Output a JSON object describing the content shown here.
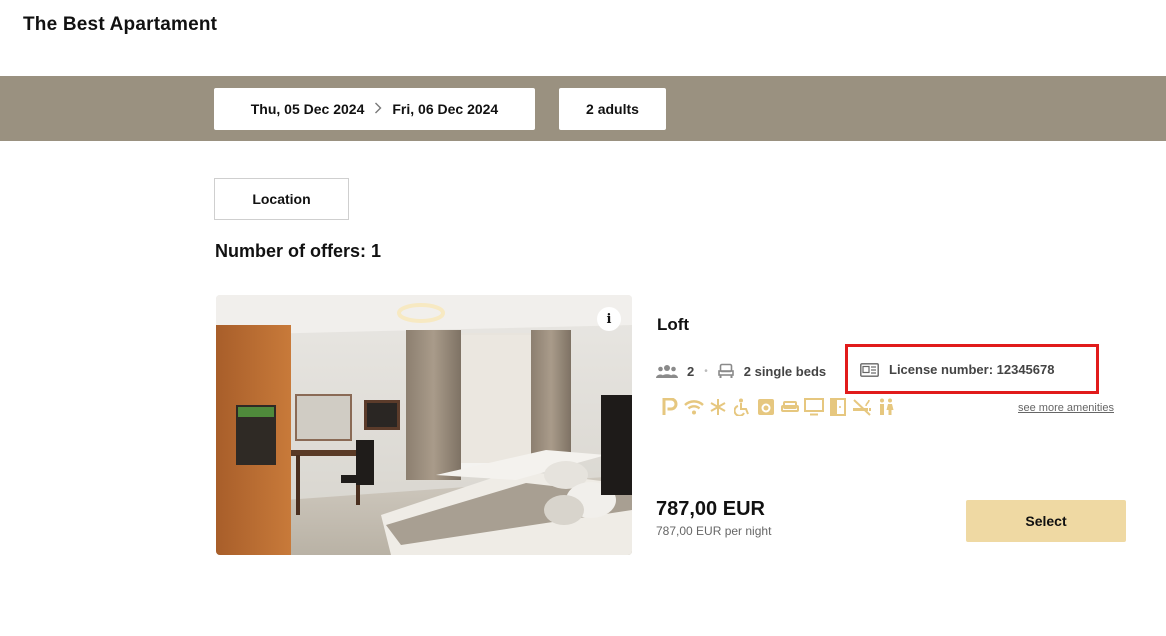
{
  "header": {
    "title": "The Best Apartament"
  },
  "search": {
    "check_in": "Thu, 05 Dec 2024",
    "check_out": "Fri, 06 Dec 2024",
    "guests": "2 adults"
  },
  "filters": {
    "location_label": "Location"
  },
  "results": {
    "count_label": "Number of offers: 1"
  },
  "offer": {
    "name": "Loft",
    "capacity": "2",
    "beds": "2 single beds",
    "license": "License number: 12345678",
    "amenities": [
      "parking",
      "wifi",
      "air-conditioning",
      "accessible",
      "washing-machine",
      "sofa",
      "tv",
      "wardrobe",
      "no-smoking",
      "toilet"
    ],
    "see_more": "see more amenities",
    "price": "787,00 EUR",
    "price_per_night": "787,00 EUR per night",
    "select_label": "Select",
    "info_label": "i"
  },
  "colors": {
    "band": "#9a9180",
    "accent": "#efd9a3",
    "amenity": "#e6c77f",
    "highlight": "#e11b1b"
  }
}
